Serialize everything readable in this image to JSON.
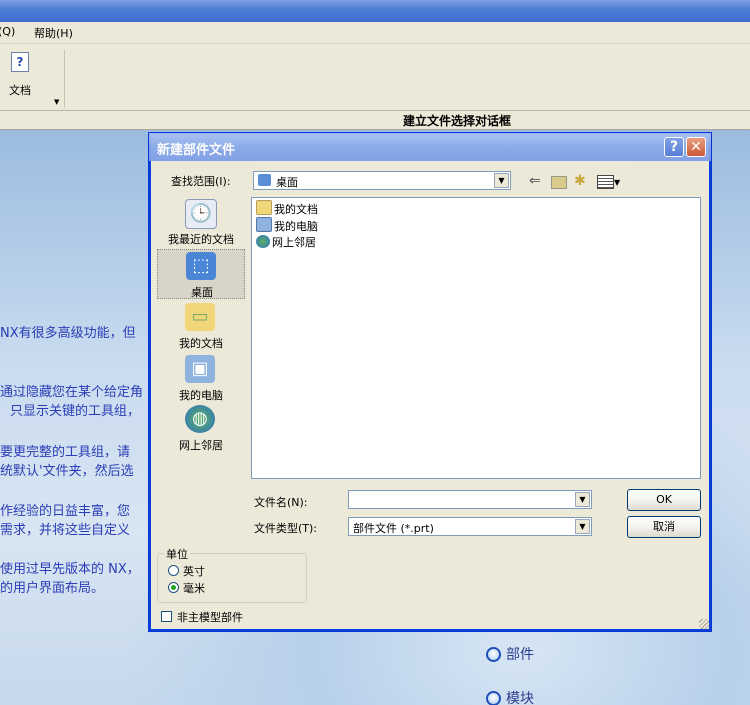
{
  "app": {
    "menu": [
      {
        "label": "(Q)"
      },
      {
        "label": "帮助(H)"
      }
    ],
    "toolbar": {
      "doc_label": "文档",
      "doc_icon": "question-doc-icon"
    },
    "cue_line": "建立文件选择对话框",
    "background_text": [
      "NX有很多高级功能，但",
      "通过隐藏您在某个给定角",
      "只显示关键的工具组，",
      "要更完整的工具组，请",
      "统默认'文件夹，然后选",
      "作经验的日益丰富，您",
      "需求，并将这些自定义",
      "使用过早先版本的 NX，",
      "的用户界面布局。"
    ],
    "links": [
      {
        "label": "部件"
      },
      {
        "label": "模块"
      }
    ]
  },
  "dialog": {
    "title": "新建部件文件",
    "help_glyph": "?",
    "close_glyph": "✕",
    "look_in_label": "查找范围(I):",
    "look_in_value": "桌面",
    "toolbar_icons": [
      "back-icon",
      "up-folder-icon",
      "new-folder-icon",
      "view-menu-icon"
    ],
    "places": [
      {
        "label": "我最近的文档",
        "icon": "recent-documents-icon"
      },
      {
        "label": "桌面",
        "icon": "desktop-icon",
        "selected": true
      },
      {
        "label": "我的文档",
        "icon": "my-documents-icon"
      },
      {
        "label": "我的电脑",
        "icon": "my-computer-icon"
      },
      {
        "label": "网上邻居",
        "icon": "network-places-icon"
      }
    ],
    "files": [
      {
        "label": "我的文档",
        "icon": "folder-icon"
      },
      {
        "label": "我的电脑",
        "icon": "computer-icon"
      },
      {
        "label": "网上邻居",
        "icon": "network-icon"
      }
    ],
    "filename_label": "文件名(N):",
    "filename_value": "",
    "filetype_label": "文件类型(T):",
    "filetype_value": "部件文件 (*.prt)",
    "ok_label": "OK",
    "cancel_label": "取消",
    "units": {
      "legend": "单位",
      "options": [
        {
          "label": "英寸",
          "selected": false
        },
        {
          "label": "毫米",
          "selected": true
        }
      ]
    },
    "non_master_label": "非主模型部件",
    "non_master_checked": false
  }
}
